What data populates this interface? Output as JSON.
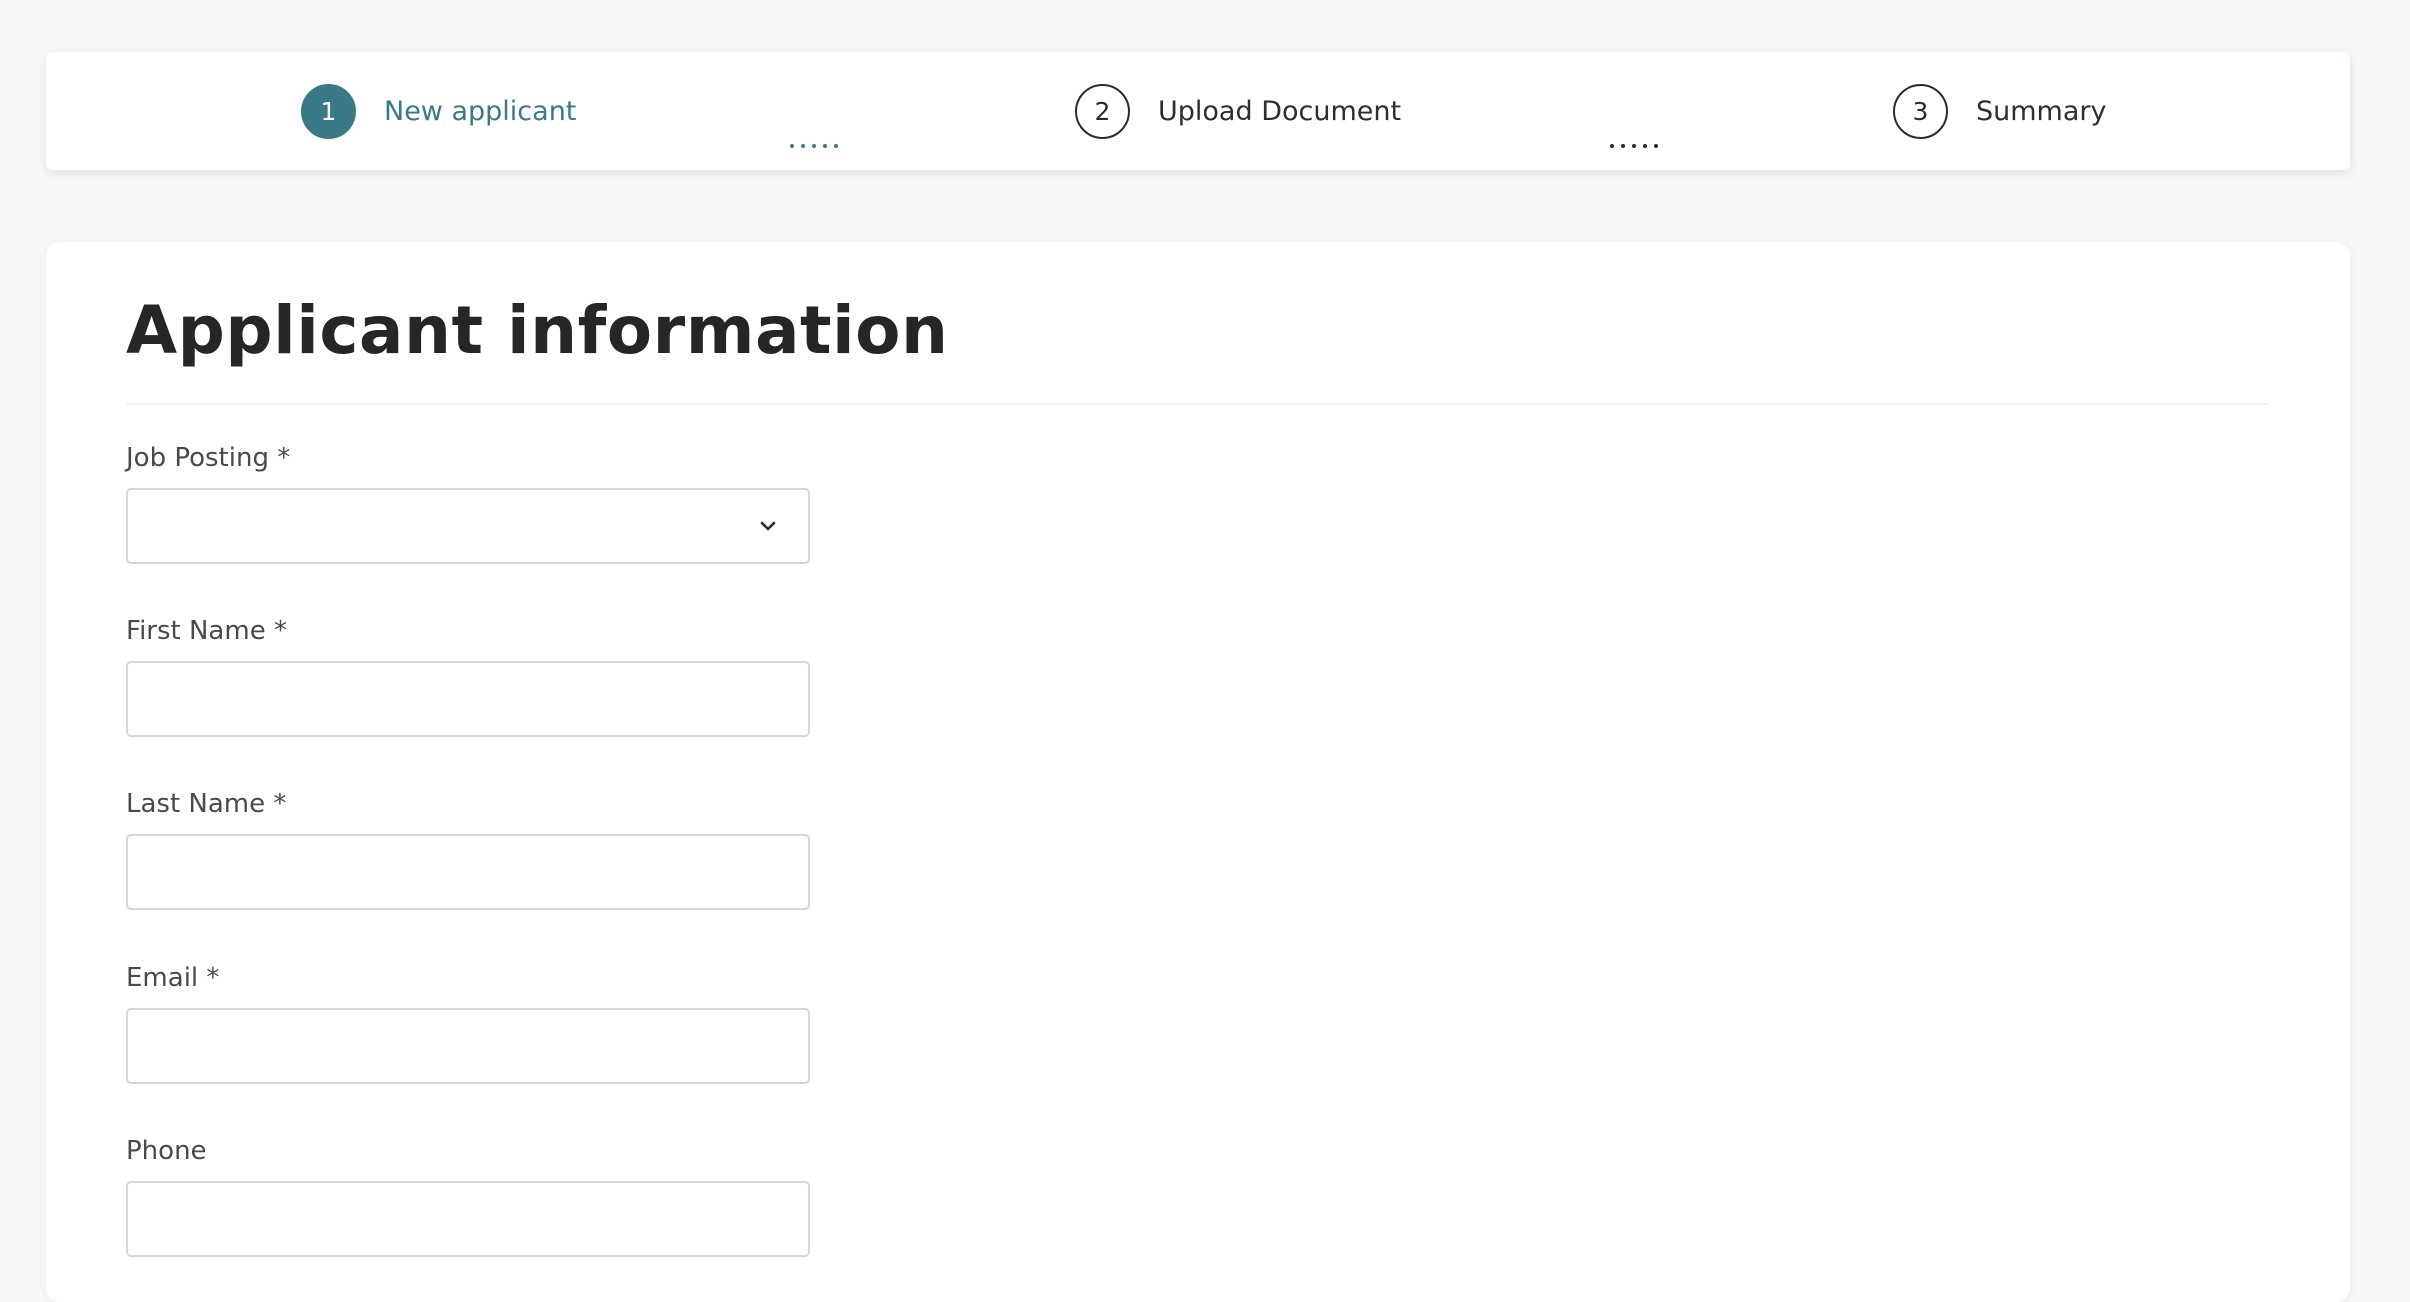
{
  "stepper": {
    "steps": [
      {
        "number": "1",
        "label": "New applicant",
        "active": true
      },
      {
        "number": "2",
        "label": "Upload Document",
        "active": false
      },
      {
        "number": "3",
        "label": "Summary",
        "active": false
      }
    ]
  },
  "form": {
    "title": "Applicant information",
    "fields": [
      {
        "label": "Job Posting *",
        "type": "select",
        "value": ""
      },
      {
        "label": "First Name *",
        "type": "text",
        "value": ""
      },
      {
        "label": "Last Name *",
        "type": "text",
        "value": ""
      },
      {
        "label": "Email *",
        "type": "text",
        "value": ""
      },
      {
        "label": "Phone",
        "type": "text",
        "value": ""
      }
    ]
  },
  "colors": {
    "accent": "#3a7a87",
    "background": "#f9f8f6"
  },
  "icons": {
    "select_icon": "chevron-down-icon"
  }
}
